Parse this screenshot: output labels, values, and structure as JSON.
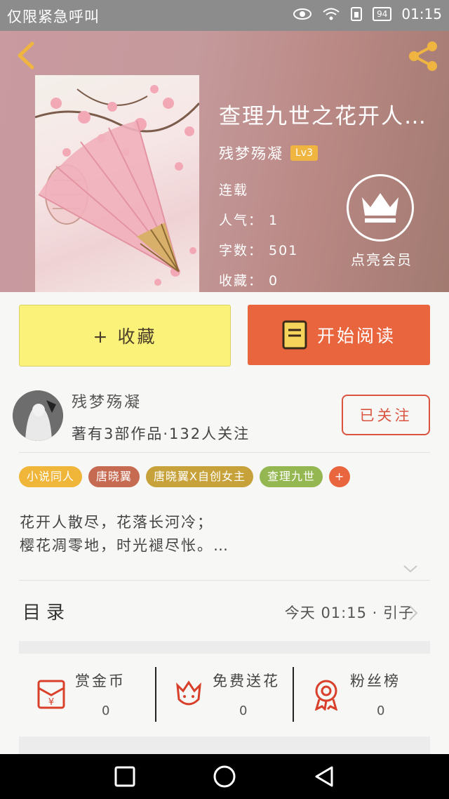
{
  "status_bar": {
    "left_text": "仅限紧急呼叫",
    "battery": "94",
    "time": "01:15"
  },
  "book": {
    "title": "查理九世之花开人…",
    "author": "残梦殇凝",
    "level": "Lv3",
    "status": "连载",
    "popularity": "人气： 1",
    "word_count": "字数： 501",
    "favorites": "收藏： 0"
  },
  "vip": {
    "label": "点亮会员"
  },
  "actions": {
    "favorite_label": "+ 收藏",
    "read_label": "开始阅读"
  },
  "author_info": {
    "name": "残梦殇凝",
    "meta": "著有3部作品·132人关注",
    "follow_label": "已关注"
  },
  "tags": [
    {
      "label": "小说同人",
      "color": "#efb63a"
    },
    {
      "label": "唐晓翼",
      "color": "#c66a52"
    },
    {
      "label": "唐晓翼X自创女主",
      "color": "#c7a23b"
    },
    {
      "label": "查理九世",
      "color": "#94b752"
    }
  ],
  "tag_more": "+",
  "description": {
    "line1": "花开人散尽，花落长河冷；",
    "line2": "樱花凋零地，时光褪尽怅。…"
  },
  "toc": {
    "label": "目录",
    "update": "今天 01:15 · 引子"
  },
  "bottom": {
    "items": [
      {
        "label": "赏金币",
        "value": "0"
      },
      {
        "label": "免费送花",
        "value": "0"
      },
      {
        "label": "粉丝榜",
        "value": "0"
      }
    ]
  },
  "colors": {
    "accent_orange": "#e9653e",
    "favorite_yellow": "#fbf279",
    "follow_red": "#d9533f"
  }
}
